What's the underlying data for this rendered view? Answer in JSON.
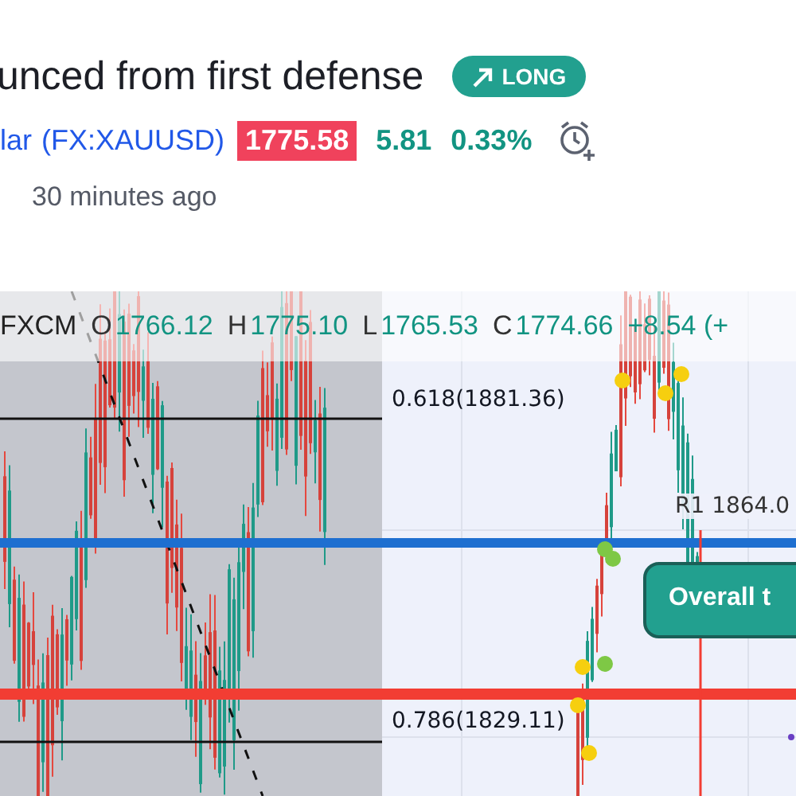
{
  "idea": {
    "title": "unced from first defense",
    "direction": {
      "kind": "long",
      "label": "LONG"
    }
  },
  "symbol": {
    "name": "lar",
    "ticker": "(FX:XAUUSD)",
    "price": "1775.58",
    "change": "5.81",
    "change_percent": "0.33%"
  },
  "published": "30 minutes ago",
  "chart": {
    "legend": {
      "source": "FXCM",
      "values": [
        {
          "key": "O",
          "value": "1766.12"
        },
        {
          "key": "H",
          "value": "1775.10"
        },
        {
          "key": "L",
          "value": "1765.53"
        },
        {
          "key": "C",
          "value": "1774.66"
        }
      ],
      "change": "+8.54 (+"
    },
    "fib_levels": [
      {
        "label": "0.618(1881.36)"
      },
      {
        "label": "0.786(1829.11)"
      }
    ],
    "pivot_label": "R1 1864.0",
    "callout": "Overall t"
  }
}
